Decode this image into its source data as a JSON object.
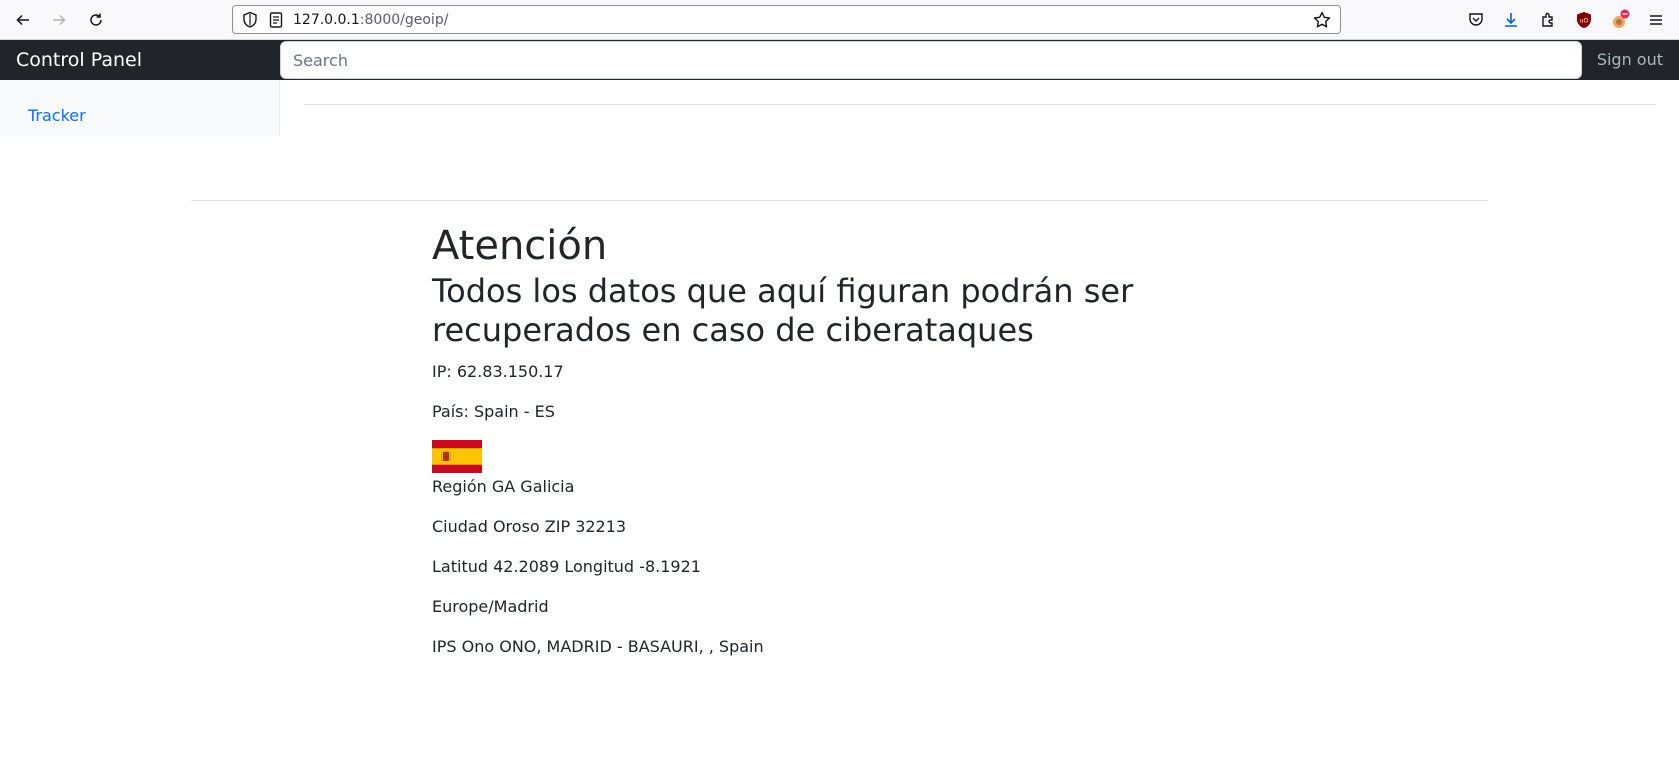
{
  "browser": {
    "url_host": "127.0.0.1",
    "url_path": ":8000/geoip/"
  },
  "navbar": {
    "brand": "Control Panel",
    "search_placeholder": "Search",
    "signout_label": "Sign out"
  },
  "sidebar": {
    "items": [
      {
        "label": "Tracker"
      }
    ]
  },
  "main": {
    "heading": "Atención",
    "subheading": "Todos los datos que aquí figuran podrán ser recuperados en caso de ciberataques",
    "ip": "IP: 62.83.150.17",
    "country": "País: Spain - ES",
    "flag_icon": "spain-flag-icon",
    "region": "Región GA Galicia",
    "city": "Ciudad Oroso ZIP 32213",
    "coords": "Latitud 42.2089 Longitud -8.1921",
    "timezone": "Europe/Madrid",
    "isp": "IPS Ono ONO, MADRID - BASAURI, , Spain"
  },
  "colors": {
    "navbar_bg": "#212529",
    "link": "#0d6efd",
    "flag_red": "#c60b1e",
    "flag_yellow": "#ffc400"
  }
}
